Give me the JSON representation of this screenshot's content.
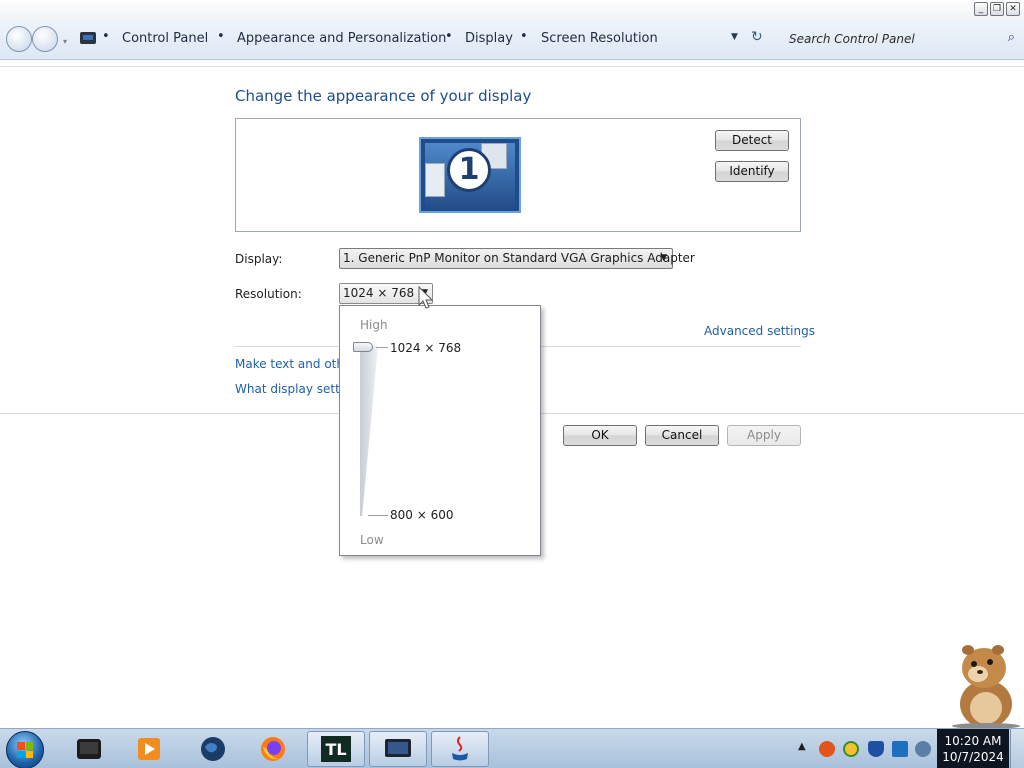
{
  "window": {
    "controls": [
      "minimize",
      "restore",
      "close"
    ]
  },
  "address_bar": {
    "breadcrumbs": [
      "Control Panel",
      "Appearance and Personalization",
      "Display",
      "Screen Resolution"
    ],
    "search_placeholder": "Search Control Panel"
  },
  "main": {
    "heading": "Change the appearance of your display",
    "monitor_number": "1",
    "detect_label": "Detect",
    "identify_label": "Identify",
    "display_label": "Display:",
    "display_value": "1. Generic PnP Monitor on Standard VGA Graphics Adapter",
    "resolution_label": "Resolution:",
    "resolution_value": "1024 × 768",
    "advanced_link": "Advanced settings",
    "link_text_size": "Make text and other",
    "link_what_display": "What display setting",
    "ok_label": "OK",
    "cancel_label": "Cancel",
    "apply_label": "Apply"
  },
  "resolution_popup": {
    "high_label": "High",
    "low_label": "Low",
    "top_value": "1024 × 768",
    "bottom_value": "800 × 600",
    "slider_level": 1.0
  },
  "taskbar": {
    "apps": [
      "media-player-icon",
      "video-player-icon",
      "earth-globe-icon",
      "firefox-icon",
      "tl-app-icon",
      "display-settings-icon",
      "java-icon"
    ],
    "clock_time": "10:20 AM",
    "clock_date": "10/7/2024"
  },
  "colors": {
    "link": "#1f5fa8",
    "heading": "#1d4e8f",
    "taskbar": "#b9cde4"
  }
}
